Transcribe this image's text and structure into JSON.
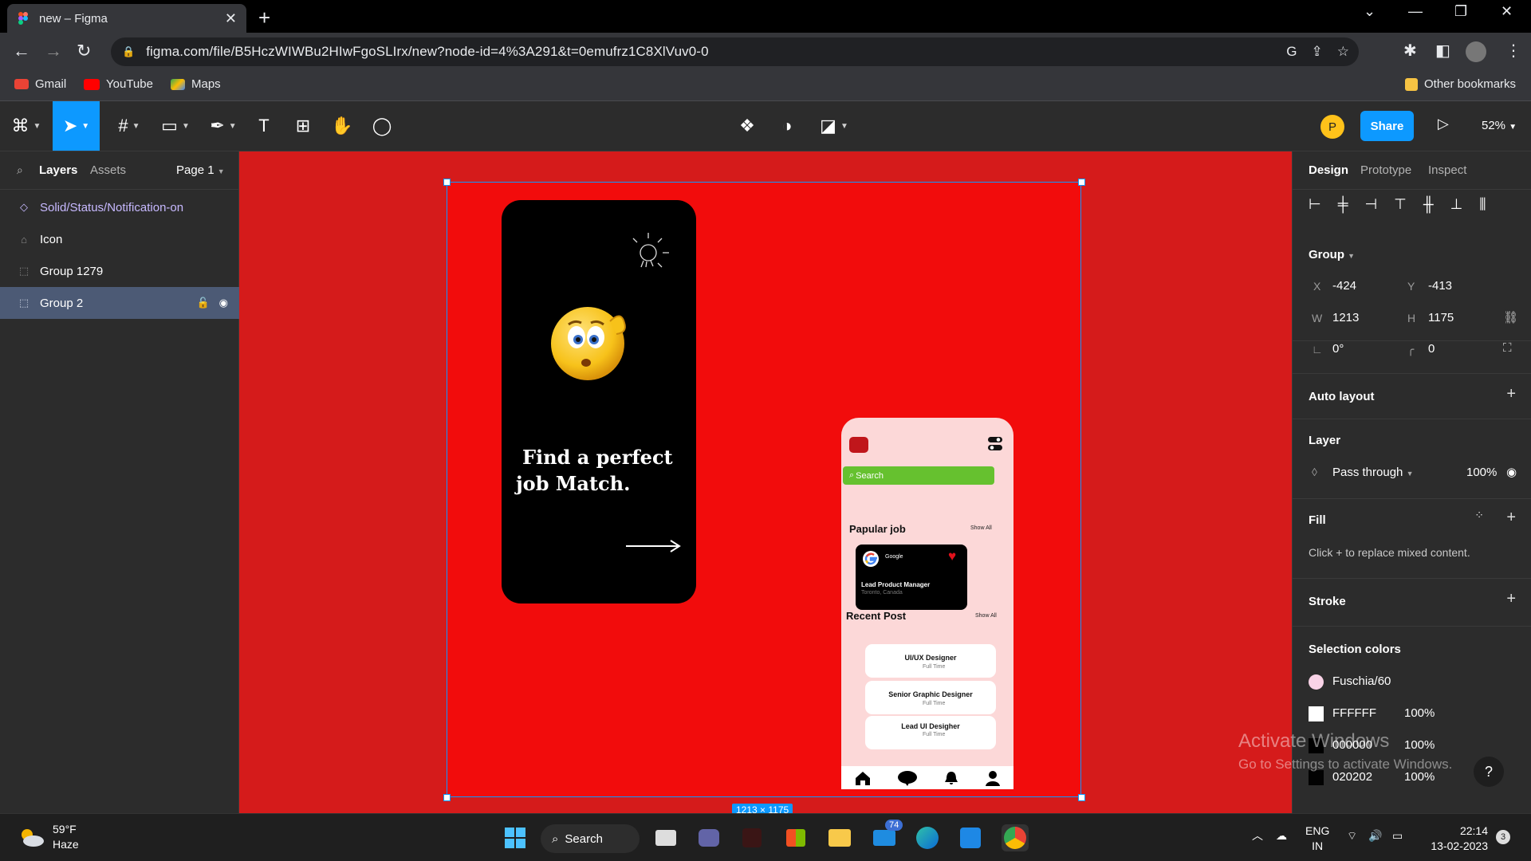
{
  "browser": {
    "tab_title": "new – Figma",
    "url": "figma.com/file/B5HczWIWBu2HIwFgoSLIrx/new?node-id=4%3A291&t=0emufrz1C8XlVuv0-0",
    "bookmarks": [
      {
        "label": "Gmail",
        "icon": "gmail-icon"
      },
      {
        "label": "YouTube",
        "icon": "youtube-icon"
      },
      {
        "label": "Maps",
        "icon": "maps-icon"
      }
    ],
    "other_bookmarks": "Other bookmarks"
  },
  "figma_toolbar": {
    "tools": [
      "figma-menu-icon",
      "move-tool-icon",
      "frame-tool-icon",
      "shape-tool-icon",
      "pen-tool-icon",
      "text-tool-icon",
      "resources-icon",
      "hand-tool-icon",
      "comment-icon"
    ],
    "center_tools": [
      "component-icon",
      "mask-icon",
      "boolean-icon"
    ],
    "avatar_initial": "P",
    "share_label": "Share",
    "zoom": "52%"
  },
  "left_panel": {
    "tab_layers": "Layers",
    "tab_assets": "Assets",
    "page": "Page 1",
    "layers": [
      {
        "name": "Solid/Status/Notification-on",
        "type": "component"
      },
      {
        "name": "Icon",
        "type": "instance"
      },
      {
        "name": "Group 1279",
        "type": "group"
      },
      {
        "name": "Group 2",
        "type": "group",
        "selected": true
      }
    ]
  },
  "canvas": {
    "dimension_badge": "1213 × 1175",
    "phone1": {
      "headline_line1": "Find a perfect",
      "headline_line2": "job Match."
    },
    "phone2": {
      "search_placeholder": "Search",
      "popular_heading": "Papular job",
      "popular_show": "Show All",
      "job_company": "Google",
      "job_role": "Lead Product Manager",
      "job_location": "Toronto, Canada",
      "recent_heading": "Recent Post",
      "recent_show": "Show All",
      "posts": [
        {
          "title": "UI/UX Designer",
          "sub": "Full Time"
        },
        {
          "title": "Senior Graphic Designer",
          "sub": "Full Time"
        },
        {
          "title": "Lead UI Desigher",
          "sub": "Full Time"
        }
      ]
    }
  },
  "right_panel": {
    "tabs": [
      "Design",
      "Prototype",
      "Inspect"
    ],
    "group_label": "Group",
    "x_label": "X",
    "x_value": "-424",
    "y_label": "Y",
    "y_value": "-413",
    "w_label": "W",
    "w_value": "1213",
    "h_label": "H",
    "h_value": "1175",
    "rotation": "0°",
    "radius": "0",
    "auto_layout": "Auto layout",
    "layer_title": "Layer",
    "blend": "Pass through",
    "opacity": "100%",
    "fill_title": "Fill",
    "fill_hint": "Click + to replace mixed content.",
    "stroke_title": "Stroke",
    "selection_colors_title": "Selection colors",
    "colors": [
      {
        "name": "Fuschia/60",
        "opacity": "",
        "hex": "#f9d3e7"
      },
      {
        "name": "FFFFFF",
        "opacity": "100%",
        "hex": "#ffffff"
      },
      {
        "name": "000000",
        "opacity": "100%",
        "hex": "#000000"
      },
      {
        "name": "020202",
        "opacity": "100%",
        "hex": "#020202"
      }
    ],
    "watermark_title": "Activate Windows",
    "watermark_sub": "Go to Settings to activate Windows."
  },
  "taskbar": {
    "temperature": "59°F",
    "condition": "Haze",
    "search": "Search",
    "mail_badge": "74",
    "lang1": "ENG",
    "lang2": "IN",
    "time": "22:14",
    "date": "13-02-2023",
    "notif": "3"
  },
  "colors": {
    "canvas_bg": "#d51b1b",
    "frame_bg": "#f20c0c",
    "accent": "#0d99ff",
    "search_green": "#66c12f",
    "phone2_bg": "#fcd8d8"
  }
}
